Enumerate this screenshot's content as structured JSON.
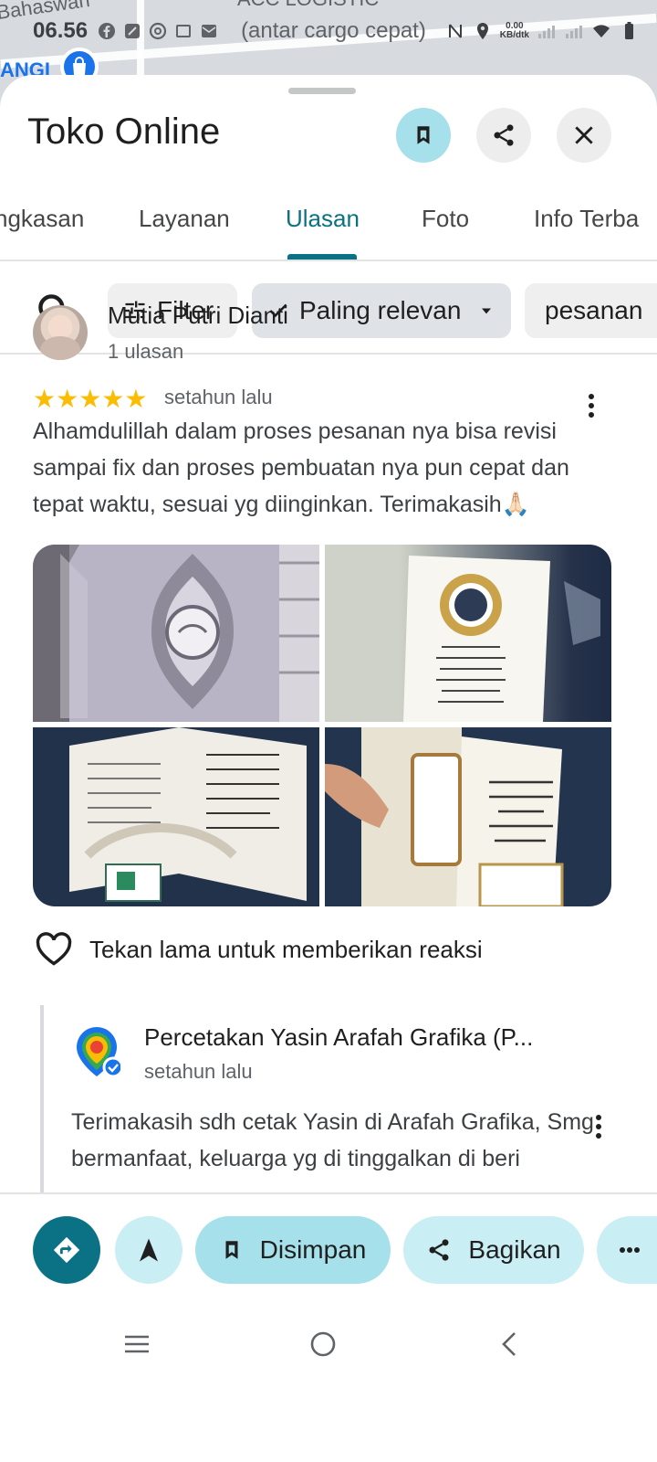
{
  "status_bar": {
    "time": "06.56",
    "network_speed_value": "0.00",
    "network_speed_unit": "KB/dtk"
  },
  "map": {
    "labels": [
      "Bahaswan",
      "ACC LOGISTIC",
      "(antar cargo cepat)",
      "ANGI"
    ]
  },
  "place": {
    "title": "Toko Online"
  },
  "header_buttons": {
    "save_icon": "bookmark-icon",
    "share_icon": "share-icon",
    "close_icon": "close-icon"
  },
  "tabs": [
    {
      "label": "ngkasan",
      "active": false
    },
    {
      "label": "Layanan",
      "active": false
    },
    {
      "label": "Ulasan",
      "active": true
    },
    {
      "label": "Foto",
      "active": false
    },
    {
      "label": "Info Terba",
      "active": false
    }
  ],
  "filters": {
    "filter_label": "Filter",
    "sort_label": "Paling relevan",
    "topic_label": "pesanan"
  },
  "review": {
    "author": "Mutia Putri Dianti",
    "author_review_count": "1 ulasan",
    "rating": 5,
    "stars": "★★★★★",
    "date": "setahun lalu",
    "text": "Alhamdulillah dalam proses pesanan nya bisa revisi sampai fix dan proses pembuatan nya pun cepat dan tepat waktu, sesuai yg diinginkan. Terimakasih🙏🏻",
    "photo_count": 4,
    "reaction_hint": "Tekan lama untuk memberikan reaksi"
  },
  "owner_reply": {
    "name": "Percetakan Yasin Arafah Grafika (P...",
    "date": "setahun lalu",
    "text": "Terimakasih sdh cetak Yasin di Arafah Grafika, Smg bermanfaat, keluarga yg di tinggalkan di beri"
  },
  "actions": {
    "directions_icon": "directions-icon",
    "start_icon": "navigation-arrow-icon",
    "saved_label": "Disimpan",
    "share_label": "Bagikan",
    "more_icon": "more-horizontal-icon"
  },
  "colors": {
    "accent": "#0b7285",
    "accent_light": "#a6e0ea",
    "chip_light": "#c9eef4",
    "star": "#fbbc04"
  }
}
